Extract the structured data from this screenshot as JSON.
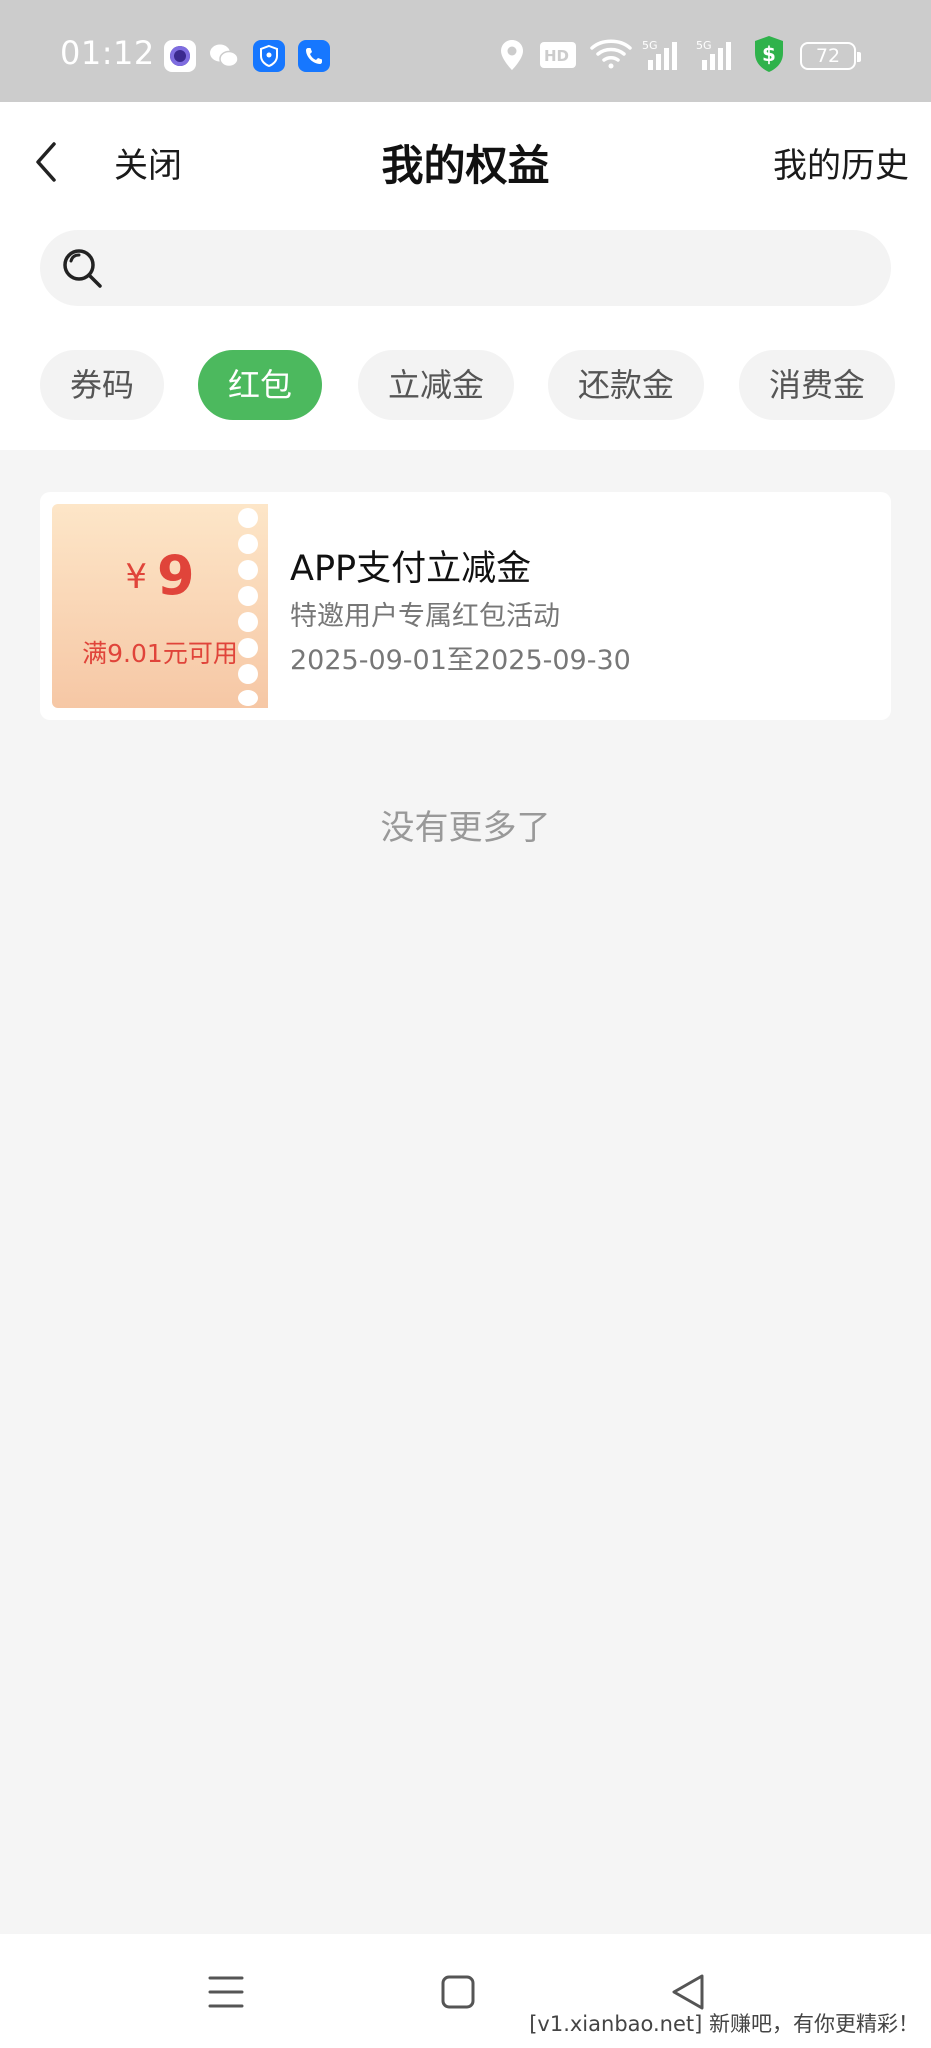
{
  "status_bar": {
    "time": "01:12",
    "battery": "72"
  },
  "header": {
    "close_label": "关闭",
    "title": "我的权益",
    "history_label": "我的历史"
  },
  "search": {
    "placeholder": "",
    "value": ""
  },
  "tabs": [
    {
      "label": "券码",
      "active": false
    },
    {
      "label": "红包",
      "active": true
    },
    {
      "label": "立减金",
      "active": false
    },
    {
      "label": "还款金",
      "active": false
    },
    {
      "label": "消费金",
      "active": false
    }
  ],
  "coupons": [
    {
      "currency": "¥",
      "amount": "9",
      "condition": "满9.01元可用",
      "name": "APP支付立减金",
      "description": "特邀用户专属红包活动",
      "validity": "2025-09-01至2025-09-30"
    }
  ],
  "list_end_text": "没有更多了",
  "watermark": "[v1.xianbao.net] 新赚吧，有你更精彩！",
  "colors": {
    "accent_green": "#4cb95e",
    "coupon_red": "#e0443a",
    "status_bar_bg": "#cccccc",
    "page_bg": "#f5f5f5"
  },
  "icons": {
    "back": "chevron-left-icon",
    "search": "search-icon",
    "nav_menu": "menu-icon",
    "nav_home": "square-icon",
    "nav_back": "triangle-back-icon"
  }
}
